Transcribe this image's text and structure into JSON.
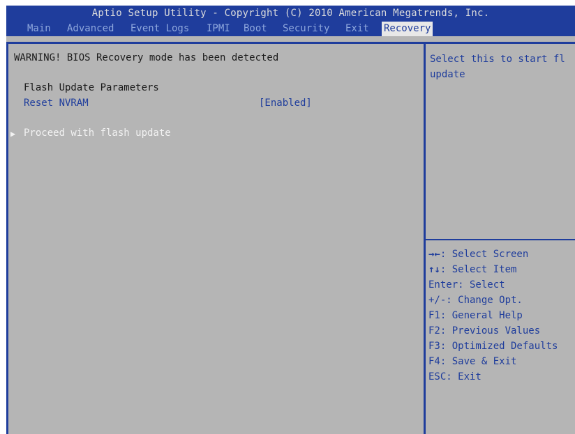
{
  "header": {
    "title": "Aptio Setup Utility - Copyright (C) 2010 American Megatrends, Inc.",
    "tabs": [
      "Main",
      "Advanced",
      "Event Logs",
      "IPMI",
      "Boot",
      "Security",
      "Exit",
      "Recovery"
    ],
    "active_tab": "Recovery"
  },
  "main": {
    "warning": "WARNING! BIOS Recovery mode has been detected",
    "section_title": "Flash Update Parameters",
    "reset_nvram_label": "Reset NVRAM",
    "reset_nvram_value": "[Enabled]",
    "proceed_label": "Proceed with flash update"
  },
  "help": {
    "line1": "Select this to start fl",
    "line2": "update"
  },
  "keys": [
    {
      "glyph": "→←",
      "text": ": Select Screen"
    },
    {
      "glyph": "↑↓",
      "text": ": Select Item"
    },
    {
      "glyph": "",
      "text": "Enter: Select"
    },
    {
      "glyph": "",
      "text": "+/-: Change Opt."
    },
    {
      "glyph": "",
      "text": "F1: General Help"
    },
    {
      "glyph": "",
      "text": "F2: Previous Values"
    },
    {
      "glyph": "",
      "text": "F3: Optimized Defaults"
    },
    {
      "glyph": "",
      "text": "F4: Save & Exit"
    },
    {
      "glyph": "",
      "text": "ESC: Exit"
    }
  ],
  "colors": {
    "bios_blue": "#1f3d9c",
    "panel_gray": "#b5b5b5",
    "highlight_white": "#f2f2f2"
  }
}
